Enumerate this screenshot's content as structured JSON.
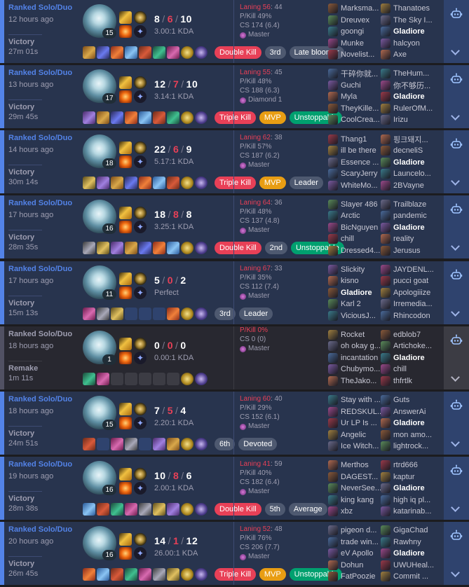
{
  "colors": {
    "win": "#5383e8",
    "remake": "#515163",
    "death": "#e84057"
  },
  "matches": [
    {
      "queue": "Ranked Solo/Duo",
      "ago": "12 hours ago",
      "result": "Victory",
      "duration": "27m 01s",
      "level": "15",
      "k": "8",
      "d": "6",
      "a": "10",
      "kda": "3.00:1 KDA",
      "badges": [
        "Double Kill",
        "3rd",
        "Late bloomer"
      ],
      "laning": "Laning 56",
      "laning_count": ": 44",
      "pkill": "P/Kill 49%",
      "cs": "CS 174 (6.4)",
      "tier": "Master",
      "team1": [
        "Marksma...",
        "Dreuvex",
        "goongi",
        "Munke",
        "Novelist..."
      ],
      "team2": [
        "Thanatoes",
        "The Sky I...",
        "Gladiore",
        "halcyon",
        "Axe"
      ]
    },
    {
      "queue": "Ranked Solo/Duo",
      "ago": "13 hours ago",
      "result": "Victory",
      "duration": "29m 45s",
      "level": "17",
      "k": "12",
      "d": "7",
      "a": "10",
      "kda": "3.14:1 KDA",
      "badges": [
        "Triple Kill",
        "MVP",
        "Unstoppable"
      ],
      "laning": "Laning 55",
      "laning_count": ": 45",
      "pkill": "P/Kill 48%",
      "cs": "CS 188 (6.3)",
      "tier": "Diamond 1",
      "team1": [
        "干碎你就...",
        "Guchi",
        "Myla",
        "TheyKille...",
        "CoolCrea..."
      ],
      "team2": [
        "TheHum...",
        "你不够历...",
        "Gladiore",
        "RulerOfM...",
        "Irizu"
      ]
    },
    {
      "queue": "Ranked Solo/Duo",
      "ago": "14 hours ago",
      "result": "Victory",
      "duration": "30m 14s",
      "level": "18",
      "k": "22",
      "d": "6",
      "a": "9",
      "kda": "5.17:1 KDA",
      "badges": [
        "Triple Kill",
        "MVP",
        "Leader"
      ],
      "laning": "Laning 62",
      "laning_count": ": 38",
      "pkill": "P/Kill 57%",
      "cs": "CS 187 (6.2)",
      "tier": "Master",
      "team1": [
        "Thang1",
        "ill be there",
        "Essence ...",
        "ScaryJerry",
        "WhiteMo..."
      ],
      "team2": [
        "핑크돼지...",
        "decneliS",
        "Gladiore",
        "Launcelo...",
        "2BVayne"
      ]
    },
    {
      "queue": "Ranked Solo/Duo",
      "ago": "17 hours ago",
      "result": "Victory",
      "duration": "28m 35s",
      "level": "16",
      "k": "18",
      "d": "8",
      "a": "8",
      "kda": "3.25:1 KDA",
      "badges": [
        "Double Kill",
        "2nd",
        "Unstoppable"
      ],
      "laning": "Laning 64",
      "laning_count": ": 36",
      "pkill": "P/Kill 48%",
      "cs": "CS 137 (4.8)",
      "tier": "Master",
      "team1": [
        "Slayer 486",
        "Arctic",
        "BicNguyen",
        "chill",
        "Dressed4..."
      ],
      "team2": [
        "Trailblaze",
        "pandemic",
        "Gladiore",
        "reality",
        "Jerusus"
      ]
    },
    {
      "queue": "Ranked Solo/Duo",
      "ago": "17 hours ago",
      "result": "Victory",
      "duration": "15m 13s",
      "level": "11",
      "k": "5",
      "d": "0",
      "a": "2",
      "kda": "Perfect",
      "badges": [
        "3rd",
        "Leader"
      ],
      "laning": "Laning 67",
      "laning_count": ": 33",
      "pkill": "P/Kill 35%",
      "cs": "CS 112 (7.4)",
      "tier": "Master",
      "team1": [
        "Slickity",
        "kisno",
        "Gladiore",
        "Karl 2",
        "ViciousJ..."
      ],
      "team2": [
        "JAYDENL...",
        "pucci goat",
        "Apologiiize",
        "Irremedia...",
        "Rhincodon"
      ]
    },
    {
      "queue": "Ranked Solo/Duo",
      "ago": "18 hours ago",
      "result": "Remake",
      "duration": "1m 11s",
      "level": "1",
      "k": "0",
      "d": "0",
      "a": "0",
      "kda": "0.00:1 KDA",
      "badges": [],
      "laning": "",
      "laning_count": "",
      "pkill": "P/Kill 0%",
      "cs": "CS 0 (0)",
      "tier": "Master",
      "team1": [
        "Rocket",
        "oh okay g...",
        "incantation",
        "Chubymo...",
        "TheJako..."
      ],
      "team2": [
        "edblob7",
        "Artichoke...",
        "Gladiore",
        "chill",
        "thfrtlk"
      ]
    },
    {
      "queue": "Ranked Solo/Duo",
      "ago": "18 hours ago",
      "result": "Victory",
      "duration": "24m 51s",
      "level": "15",
      "k": "7",
      "d": "5",
      "a": "4",
      "kda": "2.20:1 KDA",
      "badges": [
        "6th",
        "Devoted"
      ],
      "laning": "Laning 60",
      "laning_count": ": 40",
      "pkill": "P/Kill 29%",
      "cs": "CS 152 (6.1)",
      "tier": "Master",
      "team1": [
        "Stay with ...",
        "REDSKUL...",
        "Ur LP Is ...",
        "Angelic",
        "Ice Witch..."
      ],
      "team2": [
        "Guts",
        "AnswerAi",
        "Gladiore",
        "mon amo...",
        "lightrock..."
      ]
    },
    {
      "queue": "Ranked Solo/Duo",
      "ago": "19 hours ago",
      "result": "Victory",
      "duration": "28m 38s",
      "level": "16",
      "k": "10",
      "d": "8",
      "a": "6",
      "kda": "2.00:1 KDA",
      "badges": [
        "Double Kill",
        "5th",
        "Average"
      ],
      "laning": "Laning 41",
      "laning_count": ": 59",
      "pkill": "P/Kill 40%",
      "cs": "CS 182 (6.4)",
      "tier": "Master",
      "team1": [
        "Merthos",
        "DAGEST...",
        "NeverSee...",
        "king kang",
        "xbz"
      ],
      "team2": [
        "rtrd666",
        "kaptur",
        "Gladiore",
        "high iq pl...",
        "katarinab..."
      ]
    },
    {
      "queue": "Ranked Solo/Duo",
      "ago": "20 hours ago",
      "result": "Victory",
      "duration": "26m 45s",
      "level": "16",
      "k": "14",
      "d": "1",
      "a": "12",
      "kda": "26.00:1 KDA",
      "badges": [
        "Triple Kill",
        "MVP",
        "Unstoppable"
      ],
      "laning": "Laning 52",
      "laning_count": ": 48",
      "pkill": "P/Kill 76%",
      "cs": "CS 206 (7.7)",
      "tier": "Master",
      "team1": [
        "pigeon d...",
        "trade win...",
        "eV Apollo",
        "Dohun",
        "FatPoozie"
      ],
      "team2": [
        "GigaChad",
        "Rawhny",
        "Gladiore",
        "UWUHeal...",
        "Commit ..."
      ]
    }
  ]
}
